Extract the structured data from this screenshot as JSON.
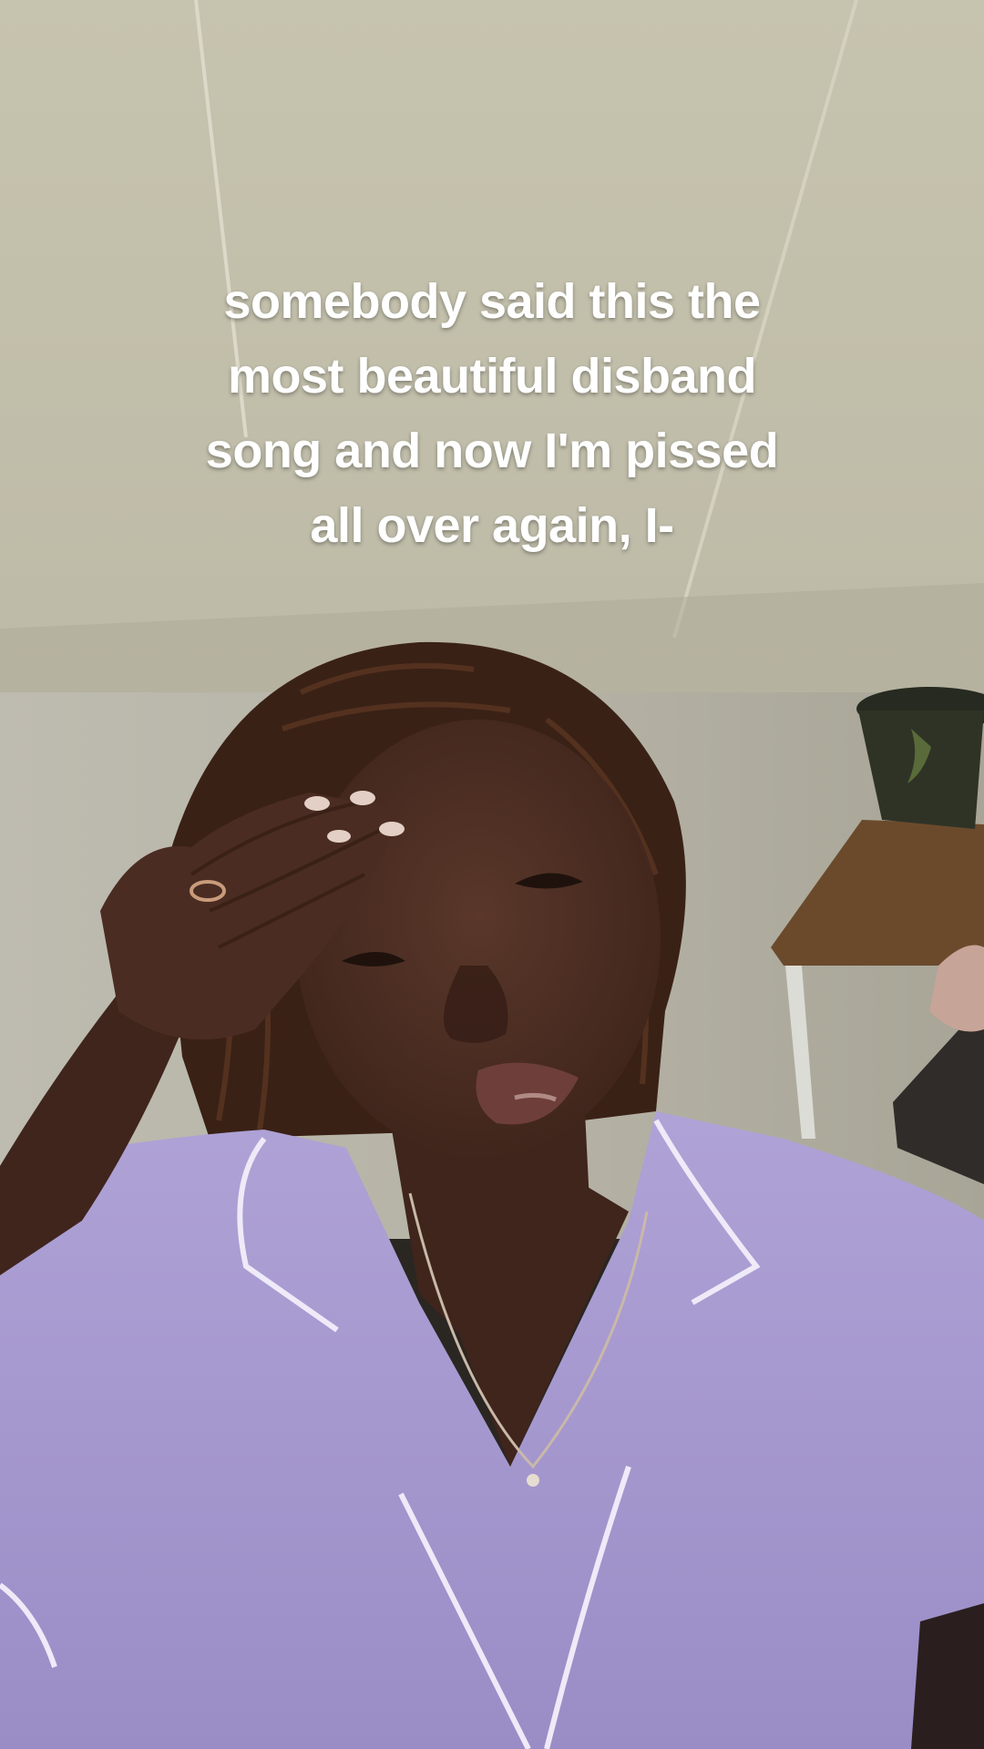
{
  "caption": {
    "lines": [
      "somebody said this the",
      "most beautiful disband",
      "song and now I'm pissed",
      "all over again, I-"
    ]
  },
  "colors": {
    "ceiling": "#c9c6b2",
    "wall": "#b9b6a6",
    "shirt": "#a79ad0",
    "shirt_piping": "#eeeaf8",
    "skin": "#4a2c22",
    "hair": "#3a2116",
    "shelf": "#6b4a2c",
    "pot": "#2f3326",
    "caption_text": "#ffffff"
  }
}
